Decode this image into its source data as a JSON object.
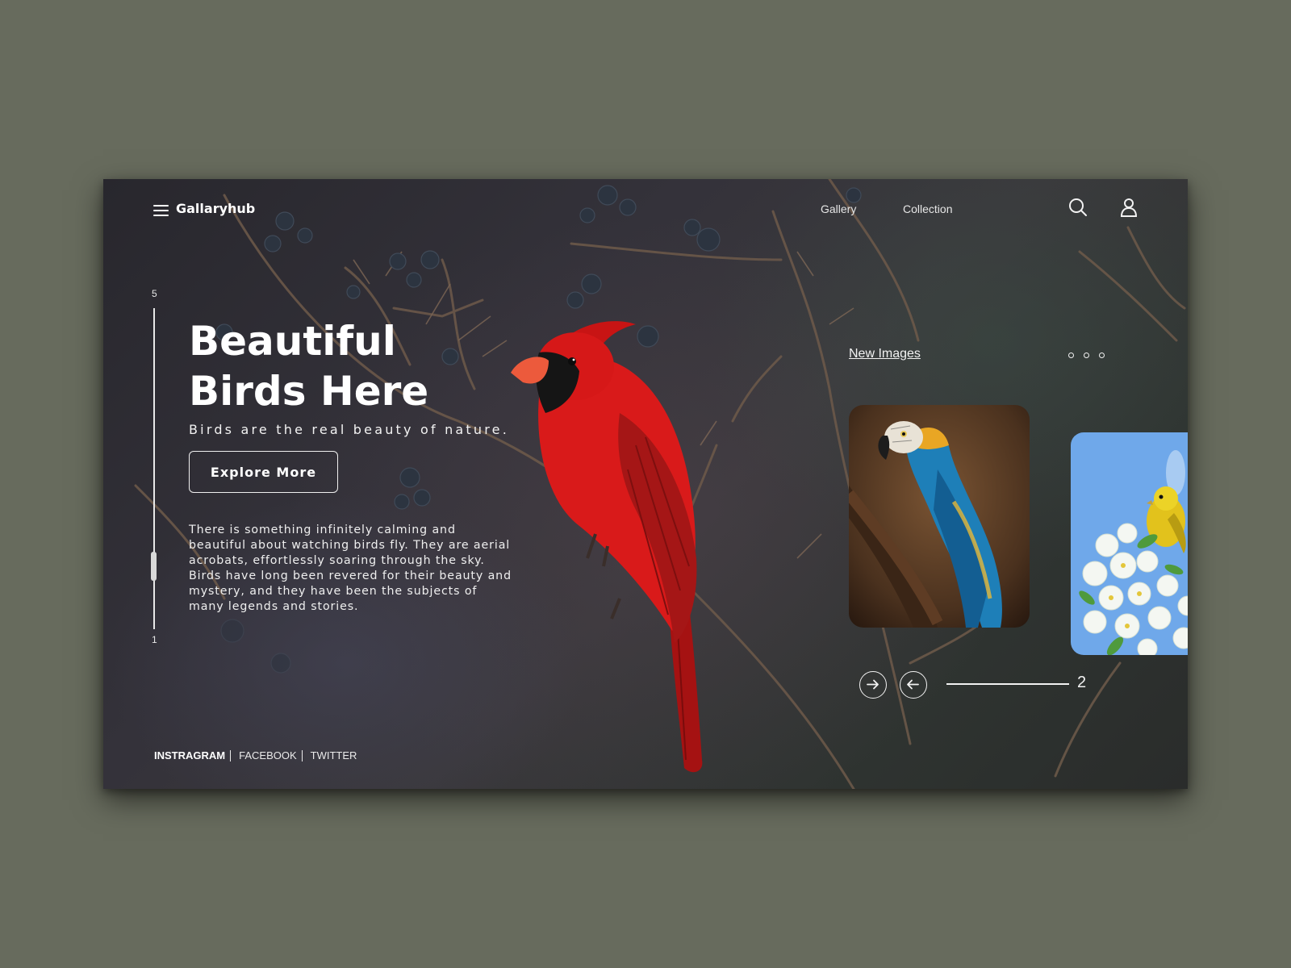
{
  "header": {
    "brand": "Gallaryhub",
    "nav": [
      {
        "label": "Gallery"
      },
      {
        "label": "Collection"
      }
    ]
  },
  "vertical_slider": {
    "top_label": "5",
    "bottom_label": "1"
  },
  "hero": {
    "title_line1": "Beautiful",
    "title_line2": "Birds Here",
    "subtitle": "Birds are the real beauty of nature.",
    "cta_label": "Explore More",
    "description": "There is something infinitely calming and beautiful about watching birds fly. They are aerial acrobats, effortlessly soaring through the sky. Birds have long been revered for their beauty and mystery, and they have been the subjects of many legends and stories."
  },
  "gallery": {
    "heading": "New Images",
    "page_number": "2"
  },
  "socials": {
    "items": [
      "INSTRAGRAM",
      "FACEBOOK",
      "TWITTER"
    ]
  },
  "colors": {
    "page_bg": "#676b5d",
    "cardinal_red": "#d91a1a",
    "macaw_blue": "#1e7fb8",
    "sky_blue": "#6fa8ea"
  },
  "icons": {
    "menu": "hamburger-icon",
    "search": "search-icon",
    "account": "user-icon",
    "next": "arrow-right-icon",
    "prev": "arrow-left-icon"
  }
}
